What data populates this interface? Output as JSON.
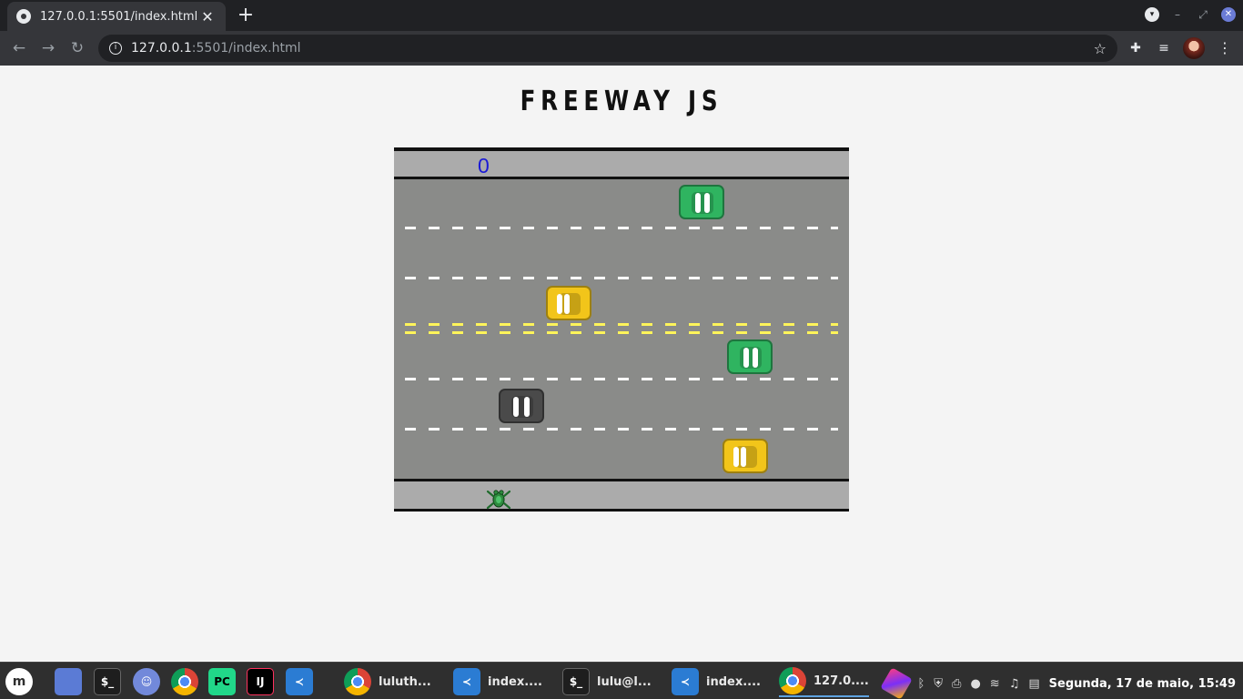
{
  "browser": {
    "tab_title": "127.0.0.1:5501/index.html",
    "close_glyph": "✕",
    "new_tab_glyph": "+",
    "url_host": "127.0.0.1",
    "url_rest": ":5501/index.html",
    "window_controls": [
      "▾",
      "–",
      "⤢",
      "✕"
    ]
  },
  "page": {
    "title": "FREEWAY JS"
  },
  "game": {
    "score": "0",
    "cars": [
      {
        "color": "green",
        "lane": 1
      },
      {
        "color": "yellow",
        "lane": 3
      },
      {
        "color": "green",
        "lane": 4
      },
      {
        "color": "black",
        "lane": 5
      },
      {
        "color": "yellow",
        "lane": 6
      }
    ],
    "colors": {
      "road": "#8a8b89",
      "sidewalk": "#ababab",
      "score": "#1a1ad6",
      "center_line": "#fff45a"
    }
  },
  "taskbar": {
    "windows": [
      {
        "label": "luluth...",
        "icon": "chrome-icon"
      },
      {
        "label": "index....",
        "icon": "vscode-icon"
      },
      {
        "label": "lulu@l...",
        "icon": "terminal-icon"
      },
      {
        "label": "index....",
        "icon": "vscode-icon"
      },
      {
        "label": "127.0....",
        "icon": "chrome-icon"
      }
    ],
    "clock": "Segunda, 17 de maio, 15:49"
  }
}
